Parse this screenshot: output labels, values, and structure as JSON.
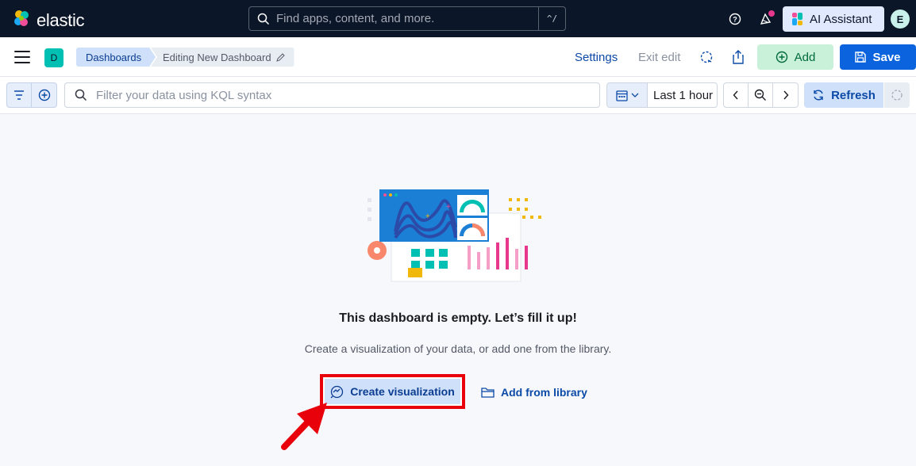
{
  "header": {
    "logo_text": "elastic",
    "search_placeholder": "Find apps, content, and more.",
    "search_shortcut": "^/",
    "ai_assistant_label": "AI Assistant",
    "user_initial": "E"
  },
  "subbar": {
    "space_initial": "D",
    "breadcrumbs": [
      "Dashboards",
      "Editing New Dashboard"
    ],
    "settings_label": "Settings",
    "exit_edit_label": "Exit edit",
    "add_label": "Add",
    "save_label": "Save"
  },
  "querybar": {
    "kql_placeholder": "Filter your data using KQL syntax",
    "time_range": "Last 1 hour",
    "refresh_label": "Refresh"
  },
  "empty_state": {
    "title": "This dashboard is empty. Let’s fill it up!",
    "description": "Create a visualization of your data, or add one from the library.",
    "create_label": "Create visualization",
    "library_label": "Add from library"
  },
  "colors": {
    "header_bg": "#0b1628",
    "primary": "#0b64dd",
    "success_bg": "#c9f0d9",
    "highlight": "#e8000b"
  },
  "icons": [
    "elastic-logo-icon",
    "search-icon",
    "help-icon",
    "news-icon",
    "ai-assistant-icon",
    "menu-icon",
    "pencil-icon",
    "background-task-icon",
    "share-icon",
    "plus-circle-icon",
    "save-icon",
    "filter-icon",
    "add-filter-icon",
    "calendar-icon",
    "chevron-down-icon",
    "chevron-left-icon",
    "zoom-out-icon",
    "chevron-right-icon",
    "refresh-icon",
    "loading-icon",
    "visualize-icon",
    "folder-icon"
  ]
}
